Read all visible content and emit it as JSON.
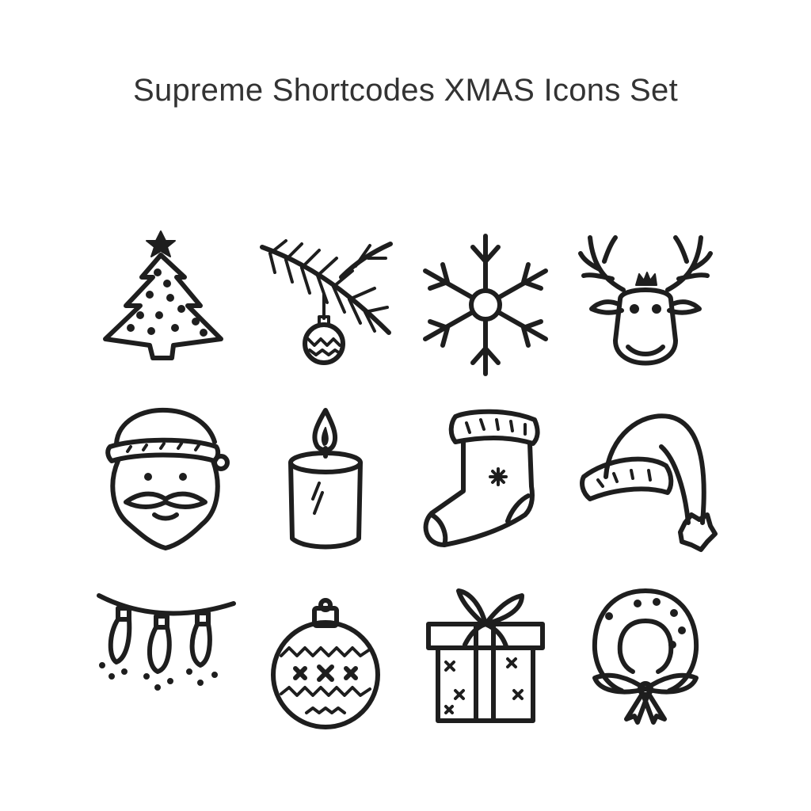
{
  "header": {
    "title": "Supreme Shortcodes XMAS Icons Set"
  },
  "ink_color": "#1e1e1e",
  "title_color": "#333333",
  "icons": [
    {
      "name": "christmas-tree-icon"
    },
    {
      "name": "pine-branch-ornament-icon"
    },
    {
      "name": "snowflake-icon"
    },
    {
      "name": "reindeer-icon"
    },
    {
      "name": "santa-claus-icon"
    },
    {
      "name": "candle-icon"
    },
    {
      "name": "christmas-stocking-icon"
    },
    {
      "name": "santa-hat-icon"
    },
    {
      "name": "string-lights-icon"
    },
    {
      "name": "bauble-ornament-icon"
    },
    {
      "name": "gift-box-icon"
    },
    {
      "name": "wreath-icon"
    }
  ]
}
